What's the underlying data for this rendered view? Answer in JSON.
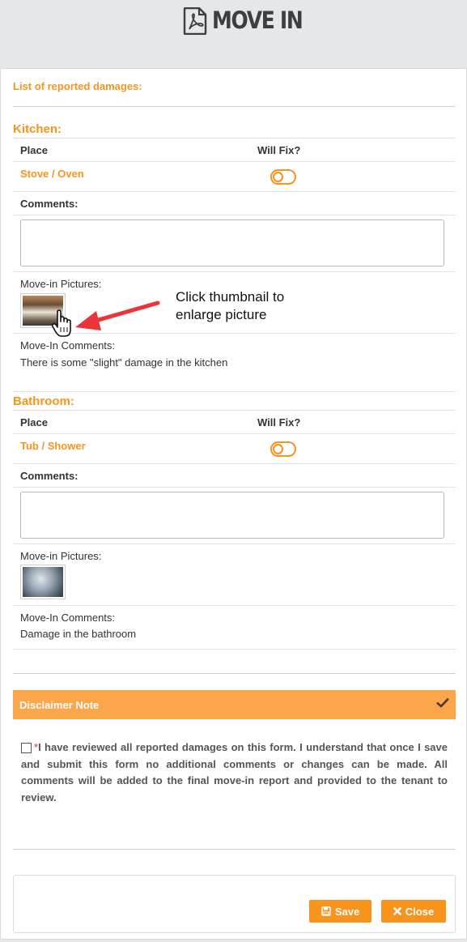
{
  "header": {
    "title": "MOVE IN",
    "icon": "pdf-icon"
  },
  "list_title": "List of reported damages:",
  "table_headers": {
    "place": "Place",
    "will_fix": "Will Fix?"
  },
  "sections": [
    {
      "name": "Kitchen:",
      "place": "Stove / Oven",
      "comments_label": "Comments:",
      "comments_value": "",
      "pictures_label": "Move-in Pictures:",
      "movein_comments_label": "Move-In Comments:",
      "movein_comments": "There is some \"slight\" damage in the kitchen",
      "will_fix": false
    },
    {
      "name": "Bathroom:",
      "place": "Tub / Shower",
      "comments_label": "Comments:",
      "comments_value": "",
      "pictures_label": "Move-in Pictures:",
      "movein_comments_label": "Move-In Comments:",
      "movein_comments": "Damage in the bathroom",
      "will_fix": false
    }
  ],
  "annotation": {
    "line1": "Click thumbnail to",
    "line2": "enlarge picture"
  },
  "disclaimer": {
    "title": "Disclaimer Note",
    "required_mark": "*",
    "text": "I have reviewed all reported damages on this form. I understand that once I save and submit this form no additional comments or changes can be made. All comments will be added to the final move-in report and provided to the tenant to review."
  },
  "buttons": {
    "save": "Save",
    "close": "Close"
  },
  "colors": {
    "accent": "#f7941d",
    "disclaimer_bg": "#fba64a",
    "arrow": "#e8343a"
  }
}
